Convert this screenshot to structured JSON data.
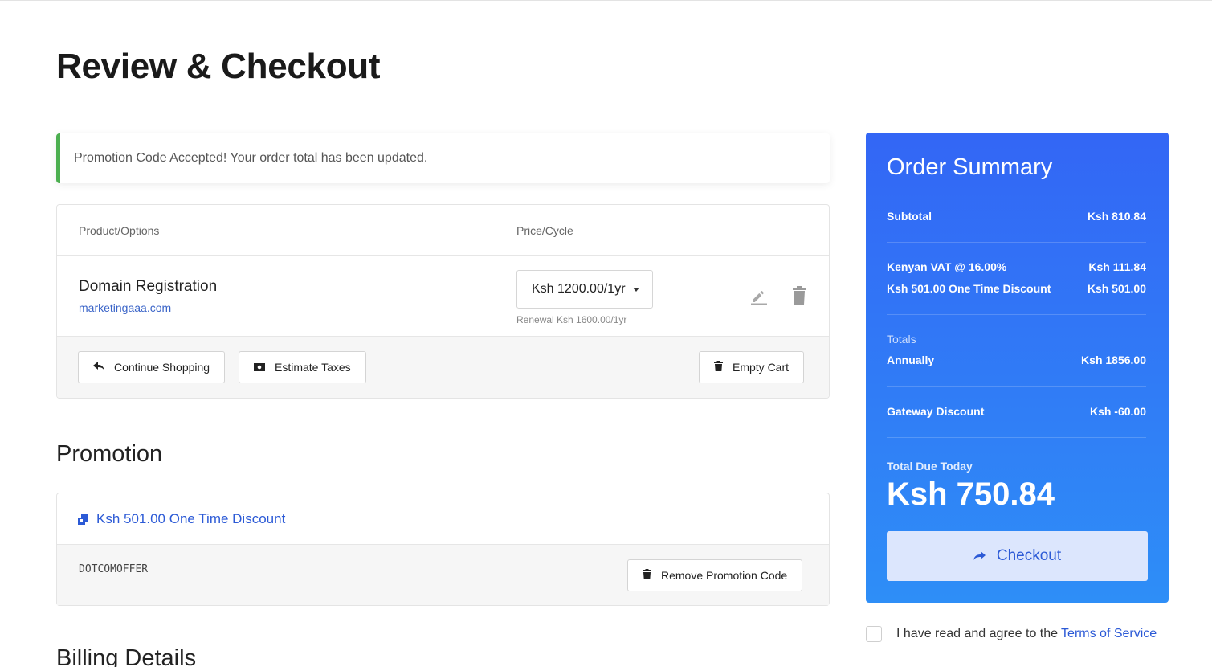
{
  "page": {
    "title": "Review & Checkout"
  },
  "alert": {
    "message": "Promotion Code Accepted! Your order total has been updated."
  },
  "cart": {
    "col_product": "Product/Options",
    "col_price": "Price/Cycle",
    "item": {
      "name": "Domain Registration",
      "domain": "marketingaaa.com",
      "cycle_selected": "Ksh 1200.00/1yr",
      "renewal": "Renewal Ksh 1600.00/1yr"
    },
    "buttons": {
      "continue": "Continue Shopping",
      "estimate": "Estimate Taxes",
      "empty": "Empty Cart"
    }
  },
  "promotion": {
    "heading": "Promotion",
    "title": "Ksh 501.00 One Time Discount",
    "code": "DOTCOMOFFER",
    "remove_label": "Remove Promotion Code"
  },
  "billing": {
    "heading": "Billing Details"
  },
  "summary": {
    "title": "Order Summary",
    "subtotal_label": "Subtotal",
    "subtotal_value": "Ksh 810.84",
    "vat_label": "Kenyan VAT @ 16.00%",
    "vat_value": "Ksh 111.84",
    "discount_label": "Ksh 501.00 One Time Discount",
    "discount_value": "Ksh 501.00",
    "totals_label": "Totals",
    "annually_label": "Annually",
    "annually_value": "Ksh 1856.00",
    "gateway_label": "Gateway Discount",
    "gateway_value": "Ksh -60.00",
    "due_label": "Total Due Today",
    "due_value": "Ksh 750.84",
    "checkout_label": "Checkout"
  },
  "tos": {
    "text": "I have read and agree to the",
    "link": "Terms of Service"
  },
  "colors": {
    "accent": "#2c5ad6",
    "summary_top": "#3366f5",
    "summary_bottom": "#2e8ef7",
    "success": "#4caf50"
  }
}
